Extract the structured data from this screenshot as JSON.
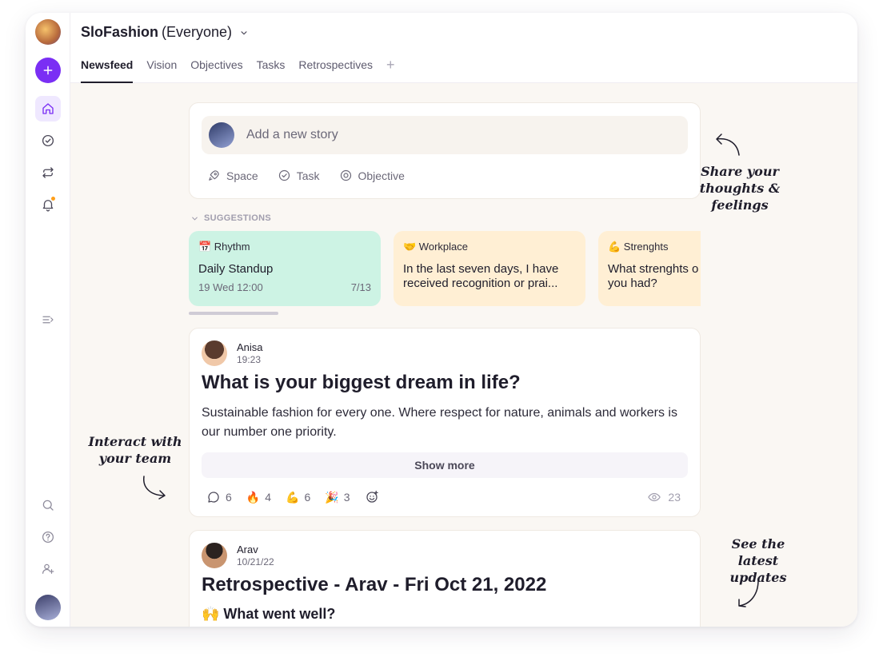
{
  "workspace": {
    "name": "SloFashion",
    "scope": "(Everyone)"
  },
  "tabs": [
    {
      "label": "Newsfeed",
      "active": true
    },
    {
      "label": "Vision"
    },
    {
      "label": "Objectives"
    },
    {
      "label": "Tasks"
    },
    {
      "label": "Retrospectives"
    }
  ],
  "composer": {
    "placeholder": "Add a new story",
    "actions": {
      "space": "Space",
      "task": "Task",
      "objective": "Objective"
    }
  },
  "suggestions": {
    "label": "SUGGESTIONS",
    "cards": [
      {
        "category": "📅 Rhythm",
        "text": "Daily Standup",
        "date": "19 Wed 12:00",
        "progress": "7/13",
        "color": "#cdf3e4"
      },
      {
        "category": "🤝 Workplace",
        "text": "In the last seven days, I have",
        "text2": "received recognition or prai...",
        "color": "#ffefd4"
      },
      {
        "category": "💪 Strenghts",
        "text": "What strenghts o",
        "text2": "you had?",
        "color": "#ffefd4"
      }
    ]
  },
  "posts": [
    {
      "author": "Anisa",
      "time": "19:23",
      "title": "What is your biggest dream in life?",
      "body": "Sustainable fashion for every one. Where respect for nature, animals and workers is our number one priority.",
      "show_more": "Show more",
      "reactions": {
        "comments": "6",
        "fire": "4",
        "muscle": "6",
        "party": "3"
      },
      "views": "23"
    },
    {
      "author": "Arav",
      "time": "10/21/22",
      "title": "Retrospective - Arav - Fri Oct 21, 2022",
      "subhead": "🙌 What went well?"
    }
  ],
  "notes": {
    "share": [
      "Share your",
      "thoughts & feelings"
    ],
    "interact": [
      "Interact with",
      "your team"
    ],
    "latest": [
      "See the latest",
      "updates"
    ]
  },
  "colors": {
    "accent": "#7a2ff4",
    "online": "#1ec39b",
    "notification": "#ff9f1a"
  }
}
